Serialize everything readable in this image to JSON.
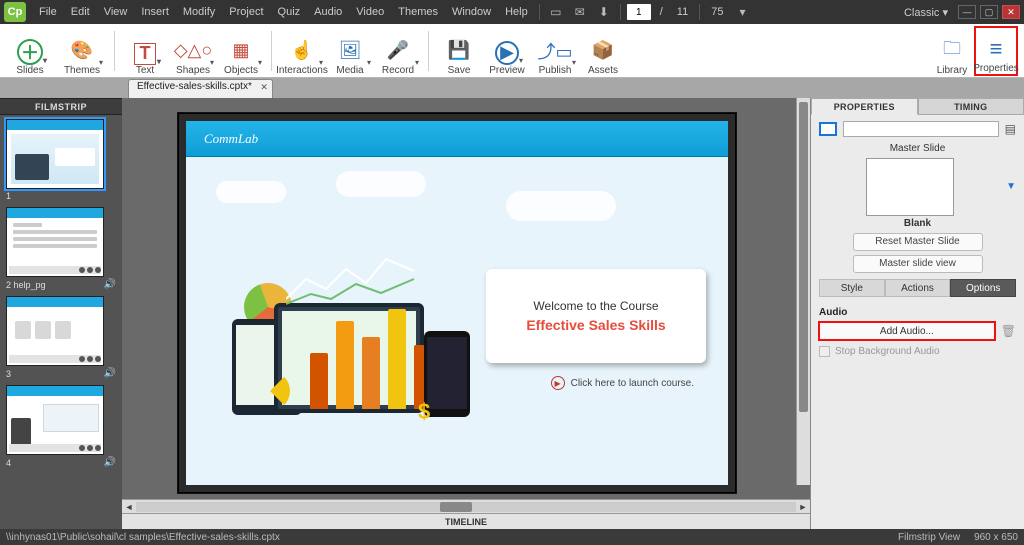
{
  "app": {
    "logo_text": "Cp"
  },
  "menu": {
    "items": [
      "File",
      "Edit",
      "View",
      "Insert",
      "Modify",
      "Project",
      "Quiz",
      "Audio",
      "Video",
      "Themes",
      "Window",
      "Help"
    ],
    "page_current": "1",
    "page_total": "11",
    "zoom": "75",
    "workspace": "Classic ▾"
  },
  "ribbon": {
    "slides": "Slides",
    "themes": "Themes",
    "text": "Text",
    "shapes": "Shapes",
    "objects": "Objects",
    "interactions": "Interactions",
    "media": "Media",
    "record": "Record",
    "save": "Save",
    "preview": "Preview",
    "publish": "Publish",
    "assets": "Assets",
    "library": "Library",
    "properties": "Properties"
  },
  "doc_tab": {
    "title": "Effective-sales-skills.cptx*"
  },
  "filmstrip": {
    "header": "FILMSTRIP",
    "items": [
      {
        "num": "1",
        "label": ""
      },
      {
        "num": "2",
        "label": "help_pg"
      },
      {
        "num": "3",
        "label": ""
      },
      {
        "num": "4",
        "label": ""
      }
    ]
  },
  "stage": {
    "brand": "CommLab",
    "welcome": "Welcome to the Course",
    "course_title": "Effective Sales Skills",
    "launch": "Click here to launch course."
  },
  "timeline_header": "TIMELINE",
  "right": {
    "tab_properties": "PROPERTIES",
    "tab_timing": "TIMING",
    "master_label": "Master Slide",
    "master_name": "Blank",
    "reset": "Reset Master Slide",
    "ms_view": "Master slide view",
    "sub_style": "Style",
    "sub_actions": "Actions",
    "sub_options": "Options",
    "audio_head": "Audio",
    "add_audio": "Add Audio...",
    "stop_bg": "Stop Background Audio"
  },
  "status": {
    "path": "\\\\inhynas01\\Public\\sohail\\cl samples\\Effective-sales-skills.cptx",
    "view": "Filmstrip View",
    "dim": "960 x 650"
  }
}
